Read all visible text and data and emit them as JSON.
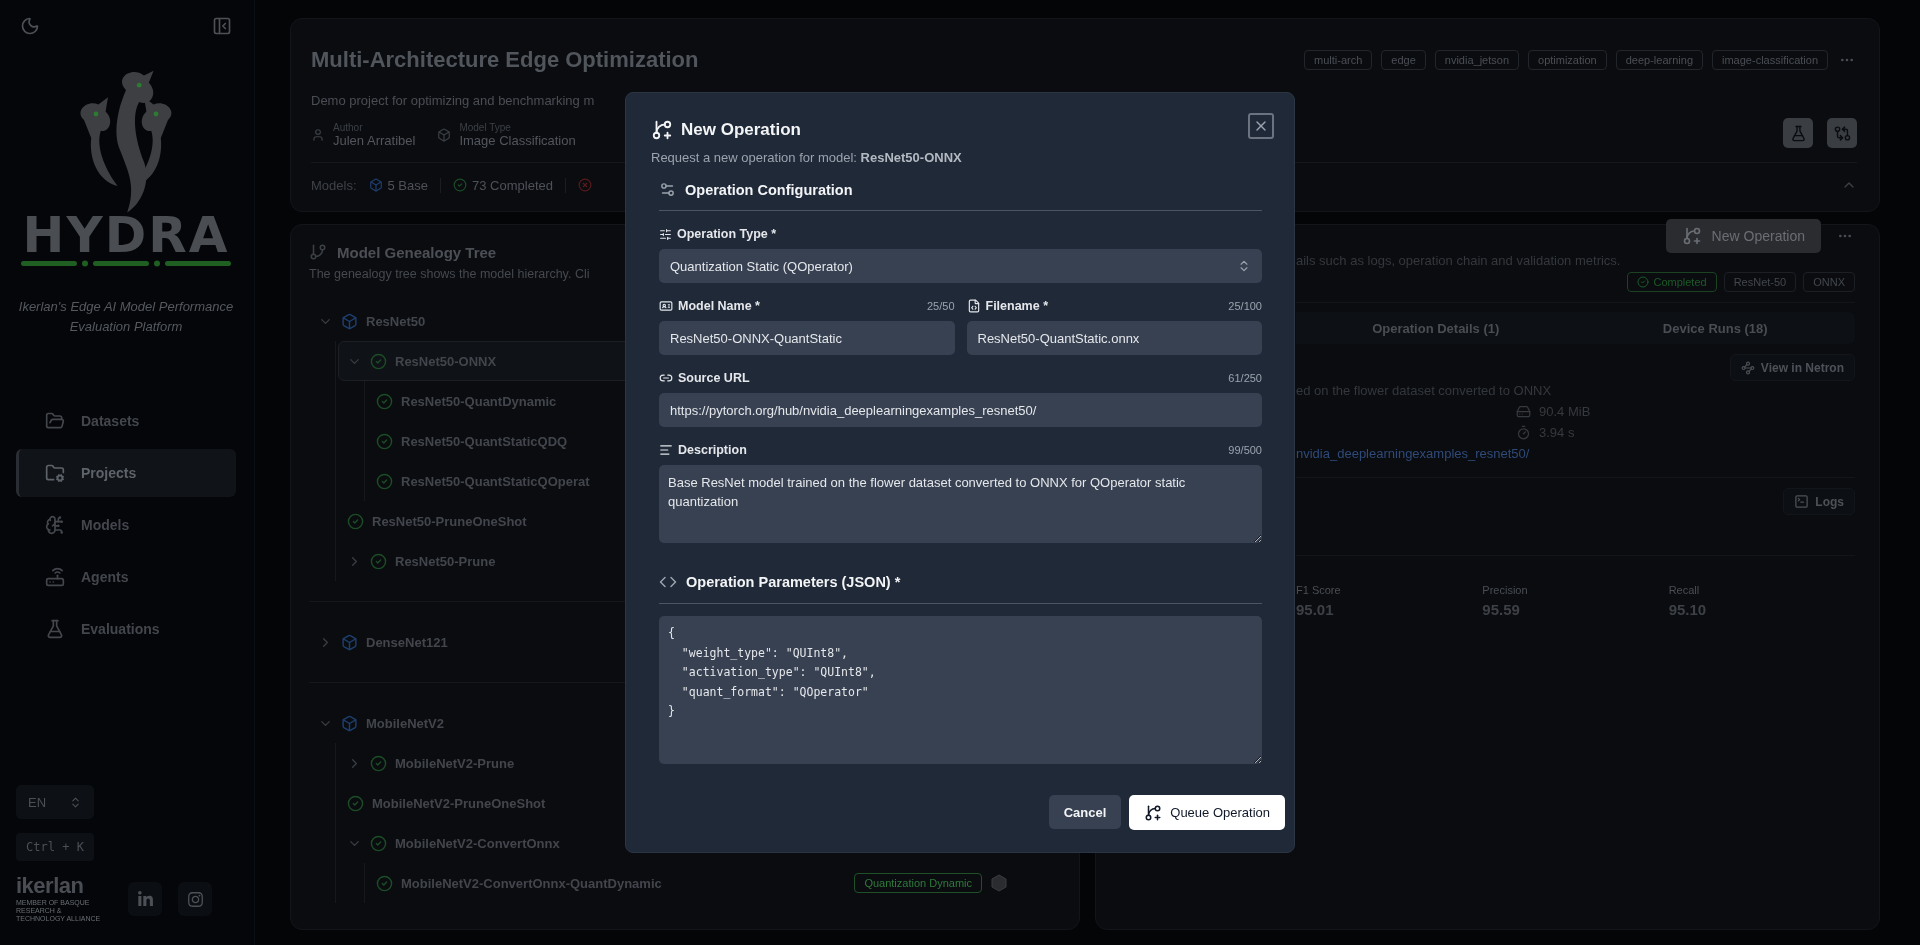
{
  "sidebar": {
    "logo_text": "HYDRA",
    "tagline": "Ikerlan's Edge AI Model Performance Evaluation Platform",
    "nav": [
      {
        "label": "Datasets",
        "selected": false
      },
      {
        "label": "Projects",
        "selected": true
      },
      {
        "label": "Models",
        "selected": false
      },
      {
        "label": "Agents",
        "selected": false
      },
      {
        "label": "Evaluations",
        "selected": false
      }
    ],
    "language": "EN",
    "shortcut": "Ctrl + K",
    "footer_logo": {
      "name": "ikerlan",
      "caption": "MEMBER OF BASQUE RESEARCH & TECHNOLOGY ALLIANCE"
    }
  },
  "project": {
    "title": "Multi-Architecture Edge Optimization",
    "tags": [
      "multi-arch",
      "edge",
      "nvidia_jetson",
      "optimization",
      "deep-learning",
      "image-classification"
    ],
    "description": "Demo project for optimizing and benchmarking m",
    "meta": [
      {
        "kind": "person",
        "label": "Author",
        "value": "Julen Arratibel"
      },
      {
        "kind": "model",
        "label": "Model Type",
        "value": "Image Classification"
      }
    ],
    "models_label": "Models:",
    "stats": [
      {
        "kind": "base",
        "text": "5 Base"
      },
      {
        "kind": "completed",
        "text": "73 Completed"
      },
      {
        "kind": "failed"
      }
    ]
  },
  "genealogy": {
    "title": "Model Genealogy Tree",
    "description": "The genealogy tree shows the model hierarchy. Cli",
    "groups": [
      {
        "name": "ResNet50",
        "kind": "base",
        "expanded": true,
        "selected": false,
        "children": [
          {
            "name": "ResNet50-ONNX",
            "kind": "derived",
            "expanded": true,
            "selected": true,
            "children": [
              {
                "name": "ResNet50-QuantDynamic",
                "kind": "derived",
                "selected": false
              },
              {
                "name": "ResNet50-QuantStaticQDQ",
                "kind": "derived",
                "selected": false
              },
              {
                "name": "ResNet50-QuantStaticQOperat",
                "kind": "derived",
                "selected": false
              }
            ]
          },
          {
            "name": "ResNet50-PruneOneShot",
            "kind": "derived",
            "selected": false
          },
          {
            "name": "ResNet50-Prune",
            "kind": "derived",
            "expanded": false,
            "selected": false
          }
        ]
      },
      {
        "name": "DenseNet121",
        "kind": "base",
        "expanded": false,
        "selected": false
      },
      {
        "name": "MobileNetV2",
        "kind": "base",
        "expanded": true,
        "selected": false,
        "children": [
          {
            "name": "MobileNetV2-Prune",
            "kind": "derived",
            "expanded": false,
            "selected": false
          },
          {
            "name": "MobileNetV2-PruneOneShot",
            "kind": "derived",
            "selected": false
          },
          {
            "name": "MobileNetV2-ConvertOnnx",
            "kind": "derived",
            "expanded": true,
            "selected": false,
            "children": [
              {
                "name": "MobileNetV2-ConvertOnnx-QuantDynamic",
                "kind": "derived",
                "selected": false,
                "badge": "Quantization Dynamic"
              }
            ]
          }
        ]
      }
    ]
  },
  "details": {
    "description_fragment": "ails such as logs, operation chain and validation metrics.",
    "button": "New Operation",
    "badges": [
      {
        "kind": "status",
        "label": "Completed"
      },
      {
        "kind": "tag",
        "label": "ResNet-50"
      },
      {
        "kind": "tag",
        "label": "ONNX"
      }
    ],
    "tabs": [
      {
        "label": "Operation Details (1)",
        "selected": false
      },
      {
        "label": "Device Runs (18)",
        "selected": false
      }
    ],
    "netron_button": "View in Netron",
    "summary_fragment": "ed on the flower dataset converted to ONNX",
    "size": "90.4 MiB",
    "duration": "3.94 s",
    "link_fragment": "nvidia_deeplearningexamples_resnet50/",
    "logs_button": "Logs",
    "metrics": [
      {
        "label": "F1 Score",
        "value": "95.01"
      },
      {
        "label": "Precision",
        "value": "95.59"
      },
      {
        "label": "Recall",
        "value": "95.10"
      }
    ]
  },
  "dialog": {
    "title": "New Operation",
    "subtitle": "Request a new operation for model: **ResNet50-ONNX**",
    "config_heading": "Operation Configuration",
    "operation_type": {
      "label": "Operation Type *",
      "value": "Quantization Static (QOperator)"
    },
    "model_name": {
      "label": "Model Name *",
      "counter": "25/50",
      "value": "ResNet50-ONNX-QuantStatic"
    },
    "filename": {
      "label": "Filename *",
      "counter": "25/100",
      "value": "ResNet50-QuantStatic.onnx"
    },
    "source_url": {
      "label": "Source URL",
      "counter": "61/250",
      "value": "https://pytorch.org/hub/nvidia_deeplearningexamples_resnet50/"
    },
    "description": {
      "label": "Description",
      "counter": "99/500",
      "value": "Base ResNet model trained on the flower dataset converted to ONNX for QOperator static quantization"
    },
    "params_heading": "Operation Parameters (JSON) *",
    "params": "{\n  \"weight_type\": \"QUInt8\",\n  \"activation_type\": \"QUInt8\",\n  \"quant_format\": \"QOperator\"\n}",
    "cancel": "Cancel",
    "submit": "Queue Operation"
  }
}
